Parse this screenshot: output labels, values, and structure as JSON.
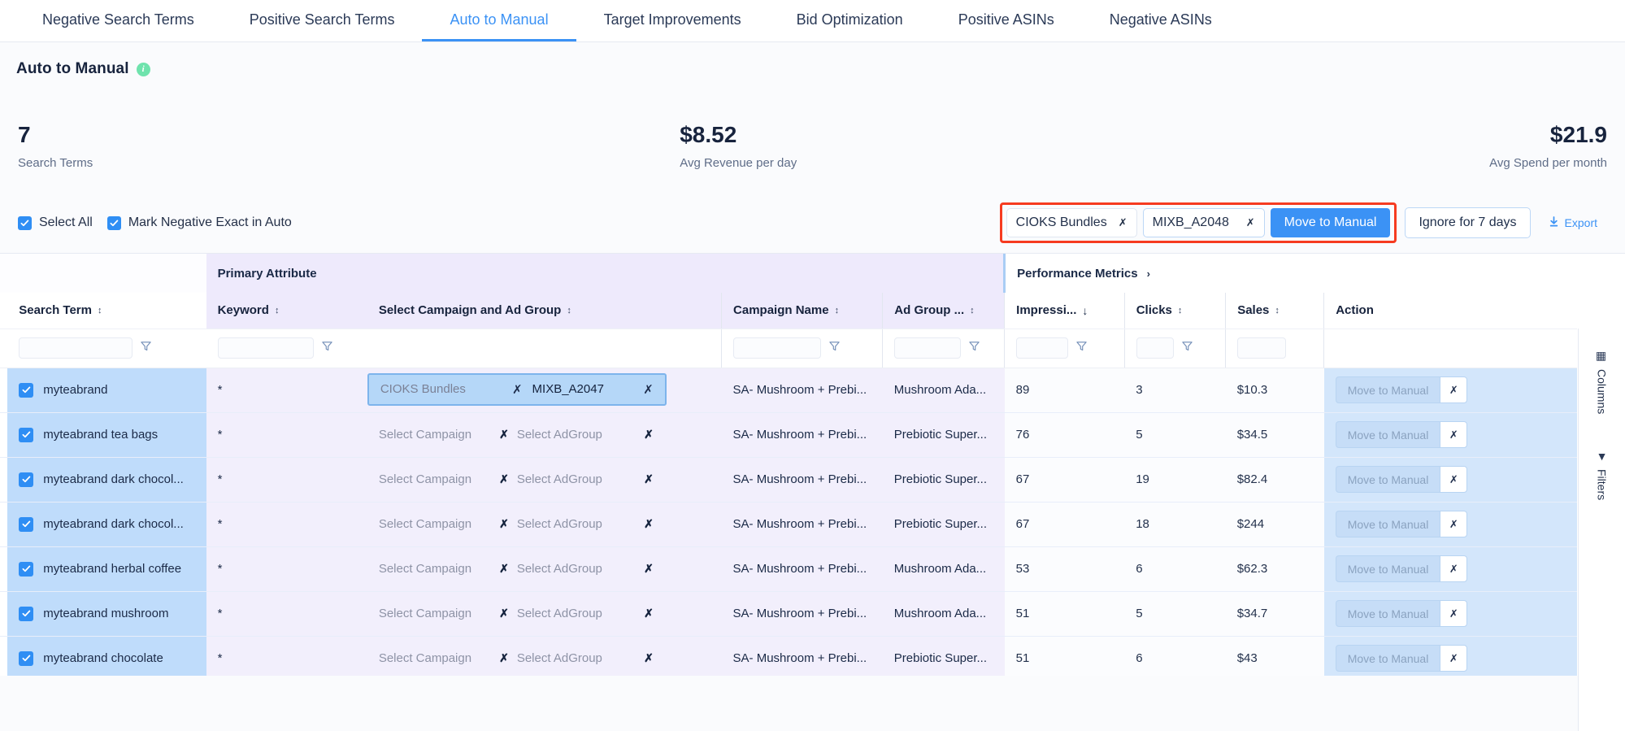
{
  "tabs": [
    {
      "label": "Negative Search Terms",
      "active": false
    },
    {
      "label": "Positive Search Terms",
      "active": false
    },
    {
      "label": "Auto to Manual",
      "active": true
    },
    {
      "label": "Target Improvements",
      "active": false
    },
    {
      "label": "Bid Optimization",
      "active": false
    },
    {
      "label": "Positive ASINs",
      "active": false
    },
    {
      "label": "Negative ASINs",
      "active": false
    }
  ],
  "page": {
    "title": "Auto to Manual",
    "info_icon": "info-icon"
  },
  "kpis": [
    {
      "value": "7",
      "label": "Search Terms"
    },
    {
      "value": "$8.52",
      "label": "Avg Revenue per day"
    },
    {
      "value": "$21.9",
      "label": "Avg Spend per month"
    }
  ],
  "toolbar": {
    "select_all_label": "Select All",
    "mark_negative_label": "Mark Negative Exact in Auto",
    "campaign_select_value": "CIOKS Bundles",
    "adgroup_select_value": "MIXB_A2048",
    "move_to_manual_label": "Move to Manual",
    "ignore_label": "Ignore for 7 days",
    "export_label": "Export",
    "highlight_color": "#f63b20",
    "primary_color": "#3b92f5"
  },
  "table": {
    "groups": [
      {
        "label": "",
        "key": "blank"
      },
      {
        "label": "Primary Attribute",
        "key": "primary"
      },
      {
        "label": "Performance Metrics",
        "key": "performance",
        "chevron": "›"
      },
      {
        "label": "",
        "key": "action"
      }
    ],
    "columns": [
      {
        "label": "Search Term",
        "sort": "both"
      },
      {
        "label": "Keyword",
        "sort": "both"
      },
      {
        "label": "Select Campaign and Ad Group",
        "sort": "both"
      },
      {
        "label": "Campaign Name",
        "sort": "both"
      },
      {
        "label": "Ad Group ...",
        "sort": "both"
      },
      {
        "label": "Impressi...",
        "sort": "desc"
      },
      {
        "label": "Clicks",
        "sort": "both"
      },
      {
        "label": "Sales",
        "sort": "both"
      },
      {
        "label": "Action",
        "sort": "none"
      }
    ],
    "rows": [
      {
        "search_term": "myteabrand",
        "keyword": "*",
        "campaign_pick": "CIOKS Bundles",
        "adgroup_pick": "MIXB_A2047",
        "selected": true,
        "campaign_name": "SA- Mushroom + Prebi...",
        "ad_group": "Mushroom Ada...",
        "impressions": "89",
        "clicks": "3",
        "sales": "$10.3",
        "action_label": "Move to Manual"
      },
      {
        "search_term": "myteabrand tea bags",
        "keyword": "*",
        "campaign_pick": "Select Campaign",
        "adgroup_pick": "Select AdGroup",
        "selected": false,
        "campaign_name": "SA- Mushroom + Prebi...",
        "ad_group": "Prebiotic Super...",
        "impressions": "76",
        "clicks": "5",
        "sales": "$34.5",
        "action_label": "Move to Manual"
      },
      {
        "search_term": "myteabrand dark chocol...",
        "keyword": "*",
        "campaign_pick": "Select Campaign",
        "adgroup_pick": "Select AdGroup",
        "selected": false,
        "campaign_name": "SA- Mushroom + Prebi...",
        "ad_group": "Prebiotic Super...",
        "impressions": "67",
        "clicks": "19",
        "sales": "$82.4",
        "action_label": "Move to Manual"
      },
      {
        "search_term": "myteabrand dark chocol...",
        "keyword": "*",
        "campaign_pick": "Select Campaign",
        "adgroup_pick": "Select AdGroup",
        "selected": false,
        "campaign_name": "SA- Mushroom + Prebi...",
        "ad_group": "Prebiotic Super...",
        "impressions": "67",
        "clicks": "18",
        "sales": "$244",
        "action_label": "Move to Manual"
      },
      {
        "search_term": "myteabrand herbal coffee",
        "keyword": "*",
        "campaign_pick": "Select Campaign",
        "adgroup_pick": "Select AdGroup",
        "selected": false,
        "campaign_name": "SA- Mushroom + Prebi...",
        "ad_group": "Mushroom Ada...",
        "impressions": "53",
        "clicks": "6",
        "sales": "$62.3",
        "action_label": "Move to Manual"
      },
      {
        "search_term": "myteabrand mushroom",
        "keyword": "*",
        "campaign_pick": "Select Campaign",
        "adgroup_pick": "Select AdGroup",
        "selected": false,
        "campaign_name": "SA- Mushroom + Prebi...",
        "ad_group": "Mushroom Ada...",
        "impressions": "51",
        "clicks": "5",
        "sales": "$34.7",
        "action_label": "Move to Manual"
      },
      {
        "search_term": "myteabrand chocolate",
        "keyword": "*",
        "campaign_pick": "Select Campaign",
        "adgroup_pick": "Select AdGroup",
        "selected": false,
        "campaign_name": "SA- Mushroom + Prebi...",
        "ad_group": "Prebiotic Super...",
        "impressions": "51",
        "clicks": "6",
        "sales": "$43",
        "action_label": "Move to Manual"
      }
    ]
  },
  "rail": {
    "columns_label": "Columns",
    "filters_label": "Filters"
  }
}
